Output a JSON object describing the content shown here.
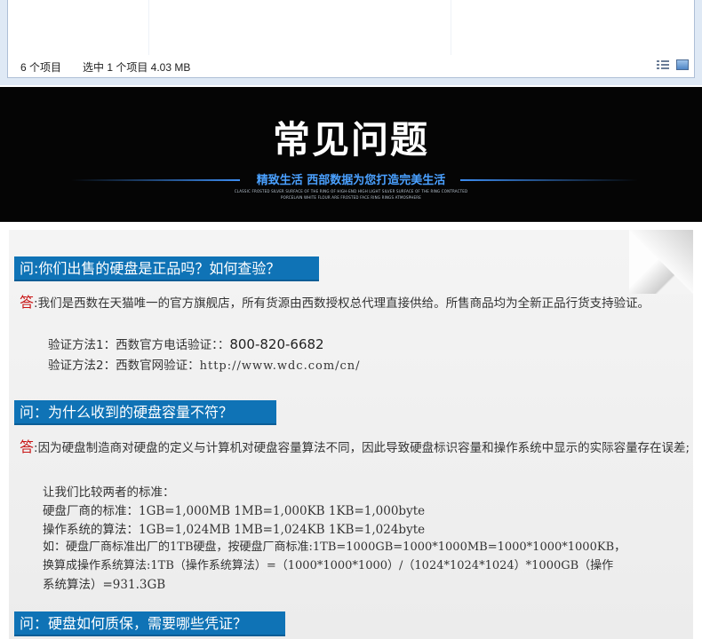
{
  "explorer": {
    "item_count": "6 个项目",
    "selected_info": "选中 1 个项目  4.03 MB",
    "icons": [
      "details-view-icon",
      "large-icons-view-icon"
    ]
  },
  "banner": {
    "title": "常见问题",
    "slogan": "精致生活   西部数据为您打造完美生活",
    "sub_line1": "CLASSIC FROSTED SILVER SURFACE OF THE RING OF HIGH-END HIGH LIGHT SILVER SURFACE OF THE RING CONTRACTED",
    "sub_line2": "PORCELAIN WHITE FLOUR ARE FROSTED FACE RING RINGS ATMOSPHERE"
  },
  "faq": {
    "q1": "问:你们出售的硬盘是正品吗？如何查验？",
    "a1_mark": "答",
    "a1_text": ":我们是西数在天猫唯一的官方旗舰店，所有货源由西数授权总代理直接供给。所售商品均为全新正品行货支持验证。",
    "a1_method1_label": "验证方法1：西数官方电话验证：：",
    "a1_method1_phone": "800-820-6682",
    "a1_method2_label": "验证方法2：西数官网验证：",
    "a1_method2_url": "http://www.wdc.com/cn/",
    "q2": "问：为什么收到的硬盘容量不符？",
    "a2_mark": "答",
    "a2_text": ":因为硬盘制造商对硬盘的定义与计算机对硬盘容量算法不同，因此导致硬盘标识容量和操作系统中显示的实际容量存在误差;",
    "a2_line1": "让我们比较两者的标准：",
    "a2_line2": "硬盘厂商的标准：1GB=1,000MB   1MB=1,000KB   1KB=1,000byte",
    "a2_line3": "操作系统的算法：1GB=1,024MB   1MB=1,024KB   1KB=1,024byte",
    "a2_line4": "如：硬盘厂商标准出厂的1TB硬盘，按硬盘厂商标准:1TB=1000GB=1000*1000MB=1000*1000*1000KB，",
    "a2_line5": "换算成操作系统算法:1TB（操作系统算法）=（1000*1000*1000）/（1024*1024*1024）*1000GB（操作",
    "a2_line6": "系统算法）=931.3GB",
    "q3": "问：硬盘如何质保，需要哪些凭证？"
  }
}
